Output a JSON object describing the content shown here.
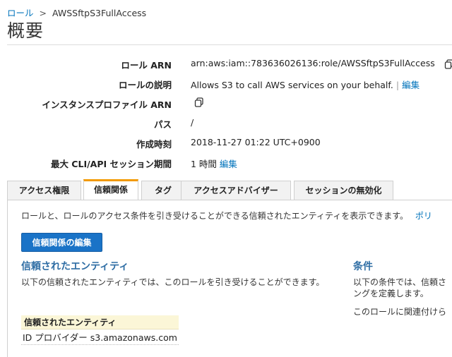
{
  "breadcrumb": {
    "root": "ロール",
    "separator": ">",
    "current": "AWSSftpS3FullAccess"
  },
  "page_title": "概要",
  "summary": {
    "role_arn_label": "ロール ARN",
    "role_arn_value": "arn:aws:iam::783636026136:role/AWSSftpS3FullAccess",
    "role_desc_label": "ロールの説明",
    "role_desc_value": "Allows S3 to call AWS services on your behalf.",
    "pipe": "|",
    "edit_link": "編集",
    "instance_profile_label": "インスタンスプロファイル ARN",
    "path_label": "パス",
    "path_value": "/",
    "created_label": "作成時刻",
    "created_value": "2018-11-27 01:22 UTC+0900",
    "max_session_label": "最大 CLI/API セッション期間",
    "max_session_value": "1 時間",
    "max_session_edit": "編集"
  },
  "tabs": [
    {
      "label": "アクセス権限"
    },
    {
      "label": "信頼関係"
    },
    {
      "label": "タグ"
    },
    {
      "label": "アクセスアドバイザー"
    },
    {
      "label": "セッションの無効化"
    }
  ],
  "active_tab": "信頼関係",
  "trust": {
    "description": "ロールと、ロールのアクセス条件を引き受けることができる信頼されたエンティティを表示できます。",
    "policy_link": "ポリ",
    "edit_button": "信頼関係の編集",
    "entities_title": "信頼されたエンティティ",
    "entities_text": "以下の信頼されたエンティティでは、このロールを引き受けることができます。",
    "table_header": "信頼されたエンティティ",
    "table_row": "ID プロバイダー s3.amazonaws.com",
    "conditions_title": "条件",
    "conditions_text": "以下の条件では、信頼さングを定義します。",
    "conditions_text2": "このロールに関連付けら"
  },
  "colors": {
    "accent": "#0073bb",
    "button": "#1a73c7",
    "tab_active": "#f29a00",
    "table_header_bg": "#fbf6d7"
  },
  "icons": {
    "copy": "copy-icon"
  }
}
